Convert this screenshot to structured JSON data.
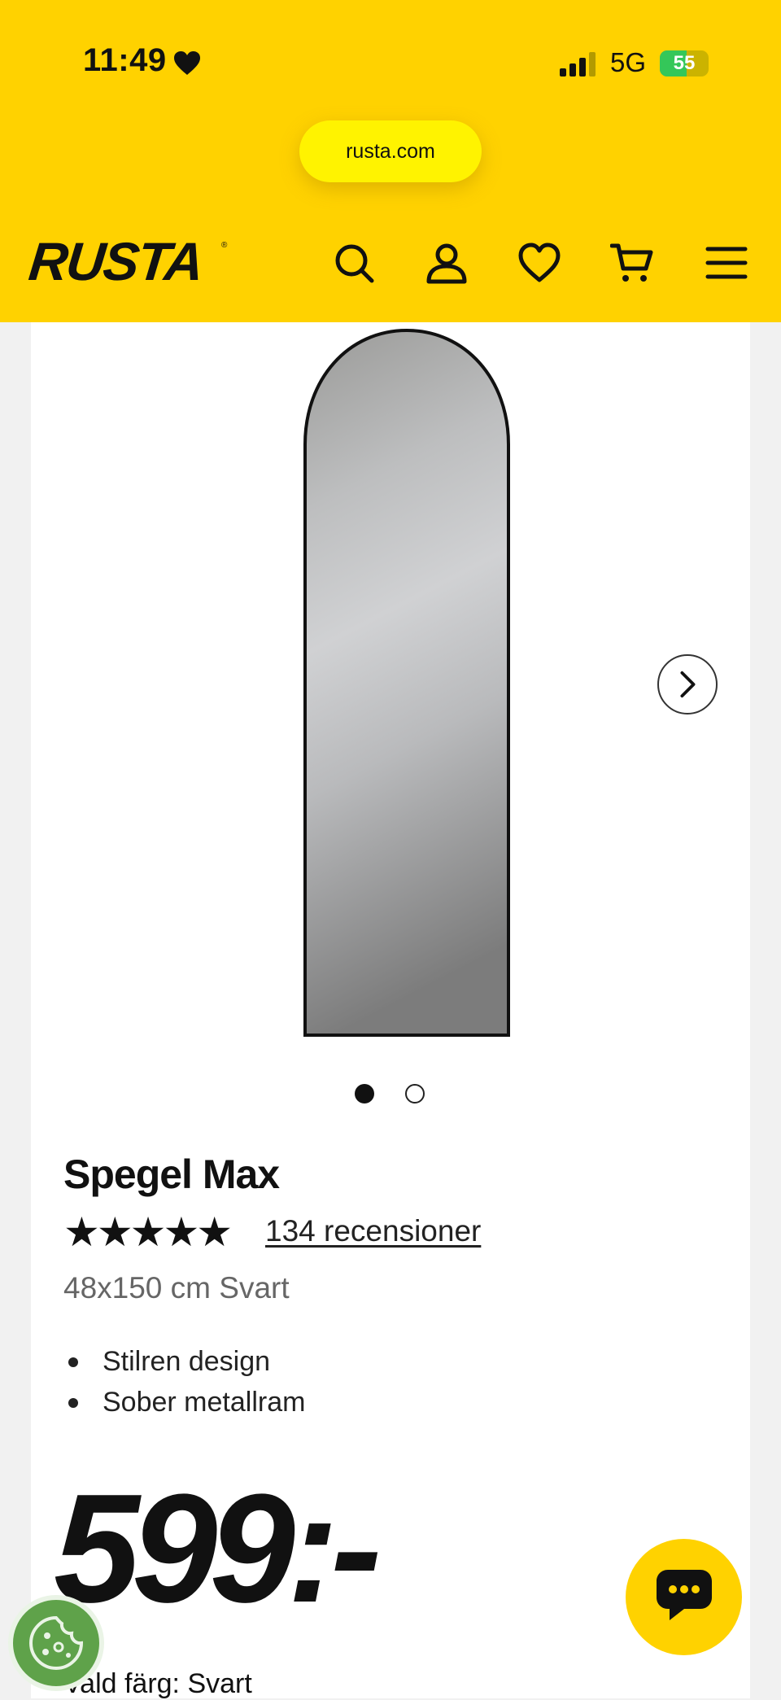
{
  "status_bar": {
    "time": "11:49",
    "network": "5G",
    "battery": "55",
    "battery_level": 0.55
  },
  "browser": {
    "url": "rusta.com"
  },
  "header": {
    "logo": "RUSTA",
    "icons": [
      "search-icon",
      "account-icon",
      "heart-icon",
      "cart-icon",
      "menu-icon"
    ]
  },
  "product": {
    "title": "Spegel Max",
    "stars": "★★★★★",
    "rating": 5,
    "reviews": "134 recensioner",
    "subtitle": "48x150 cm Svart",
    "features": [
      "Stilren design",
      "Sober metallram"
    ],
    "price": "599:-",
    "color_label": "Vald färg:",
    "color_value": "Svart"
  },
  "carousel": {
    "current": 1,
    "total": 2
  },
  "colors": {
    "brand_yellow": "#ffd200",
    "cookie_green": "#5fa24a"
  }
}
